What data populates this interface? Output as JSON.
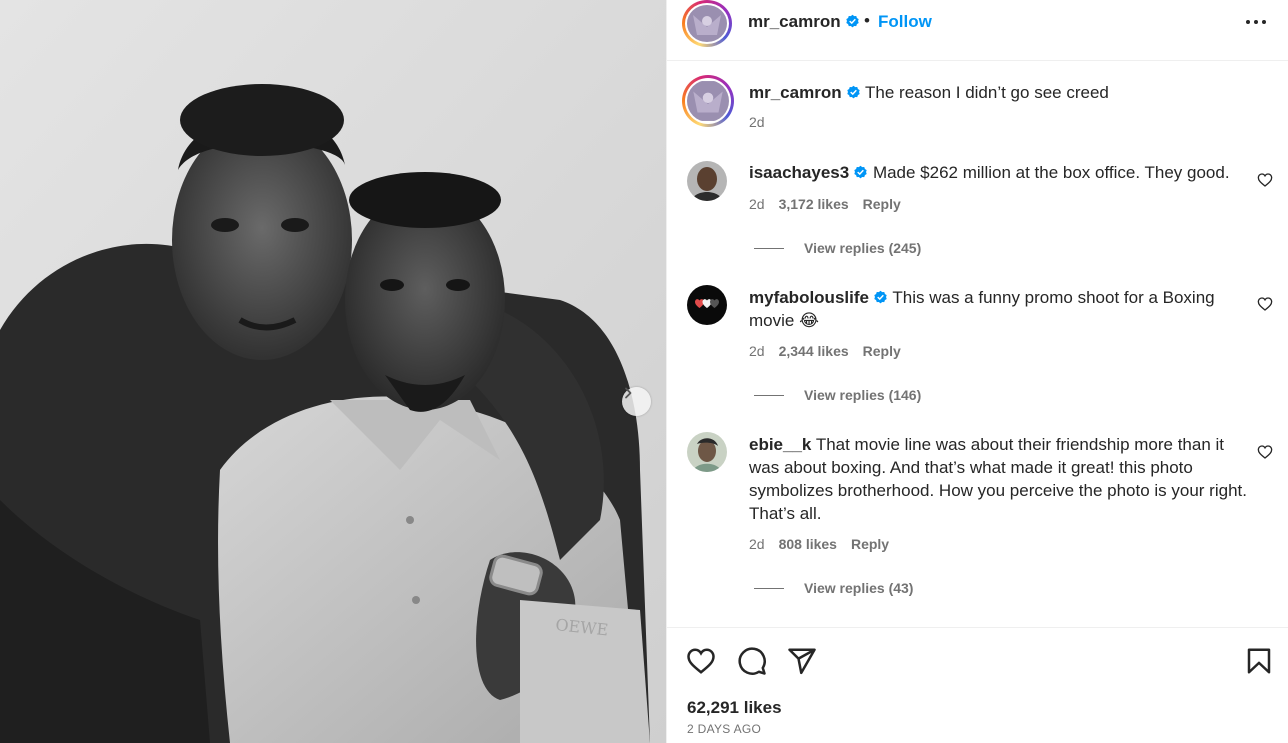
{
  "post": {
    "username": "mr_camron",
    "follow_label": "Follow",
    "separator": "•",
    "caption": "The reason I didn’t go see creed",
    "caption_age": "2d",
    "photo_logo_text": "LOEWE"
  },
  "comments": [
    {
      "username": "isaachayes3",
      "verified": true,
      "text": "Made $262 million at the box office. They good.",
      "age": "2d",
      "likes": "3,172 likes",
      "reply_label": "Reply",
      "view_replies": "View replies (245)"
    },
    {
      "username": "myfabolouslife",
      "verified": true,
      "text": "This was a funny promo shoot for a Boxing movie 😂",
      "age": "2d",
      "likes": "2,344 likes",
      "reply_label": "Reply",
      "view_replies": "View replies (146)"
    },
    {
      "username": "ebie__k",
      "verified": false,
      "text": "That movie line was about their friendship more than it was about boxing. And that’s what made it great! this photo symbolizes brotherhood. How you perceive the photo is your right. That’s all.",
      "age": "2d",
      "likes": "808 likes",
      "reply_label": "Reply",
      "view_replies": "View replies (43)"
    }
  ],
  "footer": {
    "likes": "62,291 likes",
    "date": "2 DAYS AGO"
  },
  "icons": {
    "more": "more-options-icon",
    "like": "heart-icon",
    "comment": "comment-icon",
    "share": "share-icon",
    "save": "bookmark-icon",
    "verified": "verified-badge-icon",
    "carousel": "chevron-right-icon"
  },
  "colors": {
    "accent": "#0095f6",
    "verified": "#0095f6",
    "text": "#262626",
    "secondary": "#737373",
    "border": "#efefef"
  }
}
